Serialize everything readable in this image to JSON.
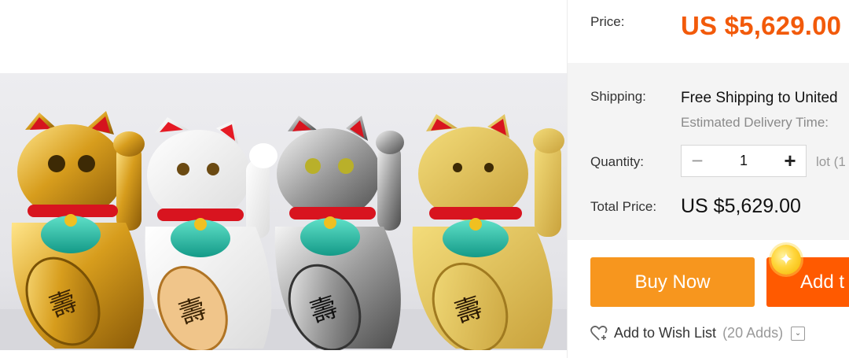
{
  "product": {
    "image_alt": "Four waving lucky cats: gold, white, silver, glitter gold"
  },
  "price": {
    "label": "Price:",
    "value": "US $5,629.00"
  },
  "shipping": {
    "label": "Shipping:",
    "value": "Free Shipping to United",
    "delivery": "Estimated Delivery Time:"
  },
  "quantity": {
    "label": "Quantity:",
    "minus": "−",
    "plus": "+",
    "value": "1",
    "lot": "lot (1"
  },
  "total": {
    "label": "Total Price:",
    "value": "US $5,629.00"
  },
  "actions": {
    "buy_now": "Buy Now",
    "add_to_cart": "Add t",
    "coin_icon": "✦"
  },
  "wishlist": {
    "label": "Add to Wish List",
    "count": "(20 Adds)",
    "caret": "⌄"
  },
  "colors": {
    "price": "#f25a0a",
    "buy_now": "#f7961e",
    "add_to_cart": "#ff5a00"
  },
  "icons": [
    "heart-plus-icon",
    "chevron-down-icon",
    "coin-icon",
    "minus-icon",
    "plus-icon"
  ]
}
